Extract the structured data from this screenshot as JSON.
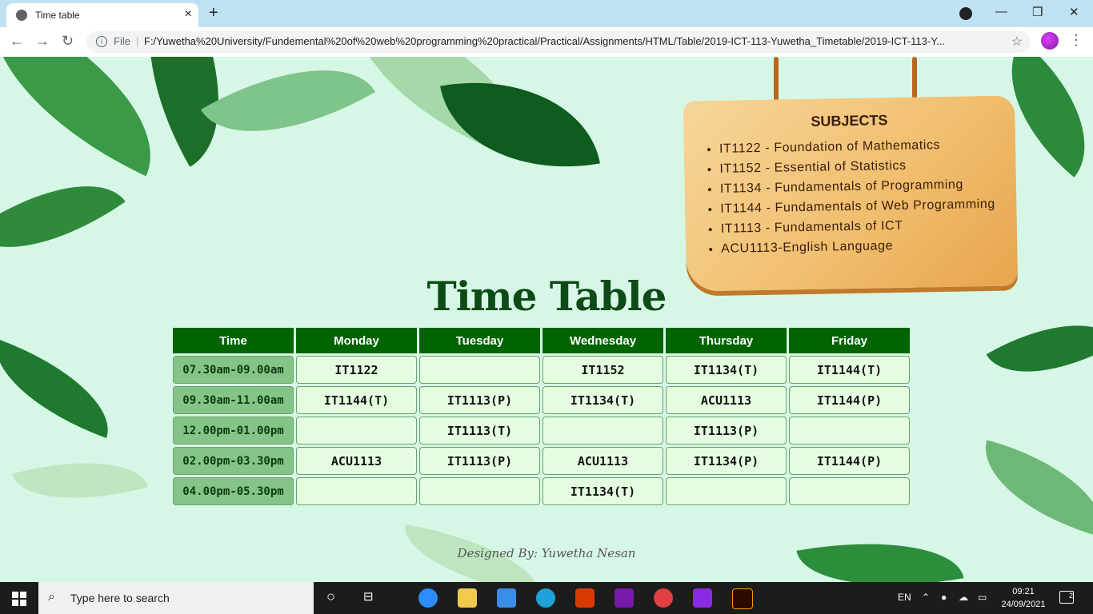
{
  "browser": {
    "tab_title": "Time table",
    "new_tab": "+",
    "close": "×",
    "file_label": "File",
    "url": "F:/Yuwetha%20University/Fundemental%20of%20web%20programming%20practical/Practical/Assignments/HTML/Table/2019-ICT-113-Yuwetha_Timetable/2019-ICT-113-Y...",
    "window": {
      "minimize": "—",
      "restore": "❐",
      "close": "✕"
    }
  },
  "subjects": {
    "title": "SUBJECTS",
    "items": [
      "IT1122 - Foundation of Mathematics",
      "IT1152 - Essential of Statistics",
      "IT1134 - Fundamentals of Programming",
      "IT1144 - Fundamentals of Web Programming",
      "IT1113 - Fundamentals of ICT",
      "ACU1113-English Language"
    ]
  },
  "page_title": "Time Table",
  "timetable": {
    "headers": [
      "Time",
      "Monday",
      "Tuesday",
      "Wednesday",
      "Thursday",
      "Friday"
    ],
    "rows": [
      [
        "07.30am-09.00am",
        "IT1122",
        "",
        "IT1152",
        "IT1134(T)",
        "IT1144(T)"
      ],
      [
        "09.30am-11.00am",
        "IT1144(T)",
        "IT1113(P)",
        "IT1134(T)",
        "ACU1113",
        "IT1144(P)"
      ],
      [
        "12.00pm-01.00pm",
        "",
        "IT1113(T)",
        "",
        "IT1113(P)",
        ""
      ],
      [
        "02.00pm-03.30pm",
        "ACU1113",
        "IT1113(P)",
        "ACU1113",
        "IT1134(P)",
        "IT1144(P)"
      ],
      [
        "04.00pm-05.30pm",
        "",
        "",
        "IT1134(T)",
        "",
        ""
      ]
    ]
  },
  "footer": "Designed By: Yuwetha Nesan",
  "taskbar": {
    "search_placeholder": "Type here to search",
    "language": "EN",
    "time": "09:21",
    "date": "24/09/2021",
    "notifications": "2"
  },
  "colors": {
    "header_bg": "#006400",
    "time_cell_bg": "#84c587",
    "cell_bg": "#e4fde0",
    "title": "#0c4a16"
  }
}
